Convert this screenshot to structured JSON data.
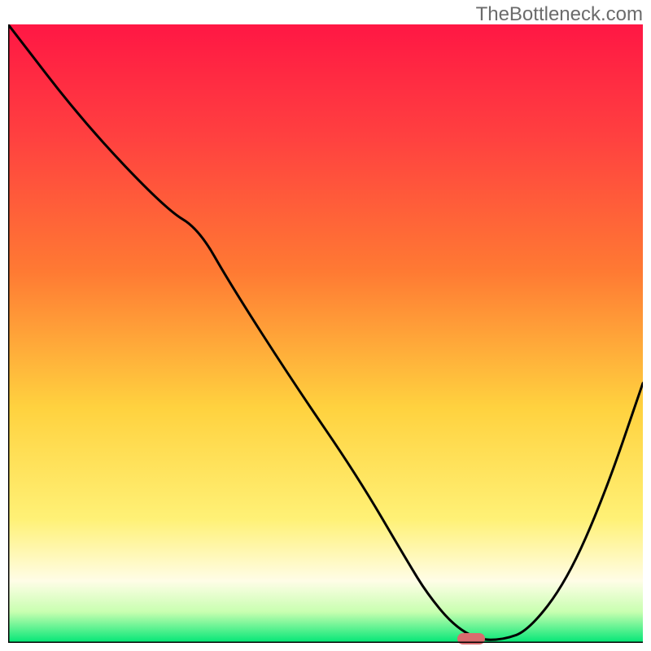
{
  "watermark": "TheBottleneck.com",
  "chart_data": {
    "type": "line",
    "title": "",
    "xlabel": "",
    "ylabel": "",
    "xlim": [
      0,
      100
    ],
    "ylim": [
      0,
      100
    ],
    "grid": false,
    "legend": false,
    "series": [
      {
        "name": "curve",
        "x": [
          0,
          12,
          25,
          30,
          35,
          45,
          55,
          63,
          66,
          70,
          74,
          78,
          82,
          88,
          94,
          100
        ],
        "values": [
          100,
          84,
          70,
          67,
          58,
          42,
          27,
          13,
          8,
          3,
          0.5,
          0.5,
          2,
          10,
          24,
          42
        ]
      }
    ],
    "marker": {
      "x": 73,
      "y": 0.7
    },
    "colors": {
      "gradient_top": "#ff1744",
      "gradient_mid1": "#ff7a33",
      "gradient_mid2": "#ffd23f",
      "gradient_mid3": "#fff176",
      "gradient_bottom": "#00e676",
      "curve": "#000000",
      "marker": "#d96b6e",
      "axis": "#000000"
    }
  }
}
